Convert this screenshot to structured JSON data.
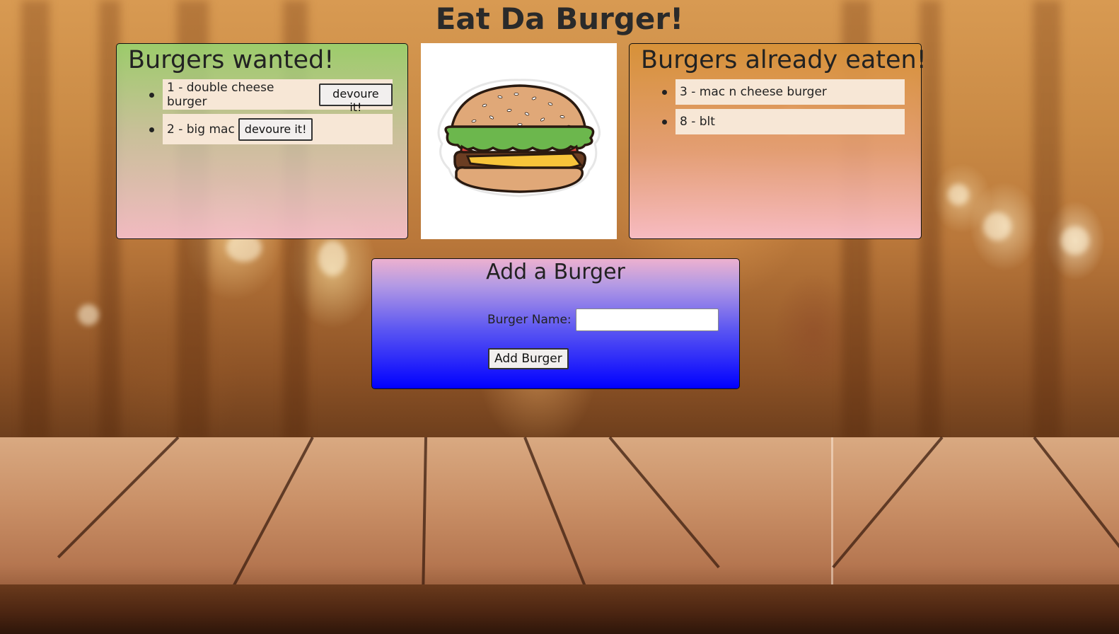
{
  "page": {
    "title": "Eat Da Burger!"
  },
  "wanted": {
    "title": "Burgers wanted!",
    "items": [
      {
        "label": "1 - double cheese burger",
        "button": "devoure it!"
      },
      {
        "label": "2 - big mac",
        "button": "devoure it!"
      }
    ]
  },
  "eaten": {
    "title": "Burgers already eaten!",
    "items": [
      {
        "label": "3 - mac n cheese burger"
      },
      {
        "label": "8 - blt"
      }
    ]
  },
  "add_form": {
    "title": "Add a Burger",
    "name_label": "Burger Name:",
    "name_value": "",
    "submit_label": "Add Burger"
  },
  "image": {
    "icon": "burger-illustration"
  }
}
